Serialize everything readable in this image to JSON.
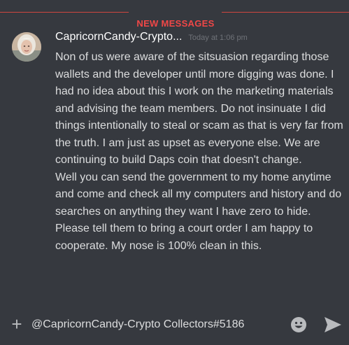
{
  "divider": {
    "label": "NEW MESSAGES"
  },
  "message": {
    "username": "CapricornCandy-Crypto...",
    "timestamp": "Today at 1:06 pm",
    "paragraphs": [
      "Non of us were aware of the sitsuasion regarding those wallets and the developer until more digging was done. I had no idea about this I work on the marketing materials and advising the team members. Do not insinuate I did things intentionally to steal or scam as that is very far from the truth. I am just as upset as everyone else. We are continuing to build Daps coin that doesn't change.",
      "Well you can send the government to my home anytime and come and check all my computers and history and do searches on anything they want I have zero to hide. Please tell them to bring a court order I am happy to cooperate. My nose is 100% clean in this."
    ]
  },
  "composer": {
    "plus_glyph": "+",
    "input_value": "@CapricornCandy-Crypto Collectors#5186"
  },
  "icons": {
    "add": "plus-icon",
    "emoji": "emoji-icon",
    "send": "send-icon"
  },
  "colors": {
    "background": "#36393f",
    "divider": "#d0463f",
    "divider_text": "#f04747",
    "username": "#ffffff",
    "message_text": "#dcddde",
    "timestamp": "#6f7278",
    "icon": "#b9bbbe"
  }
}
